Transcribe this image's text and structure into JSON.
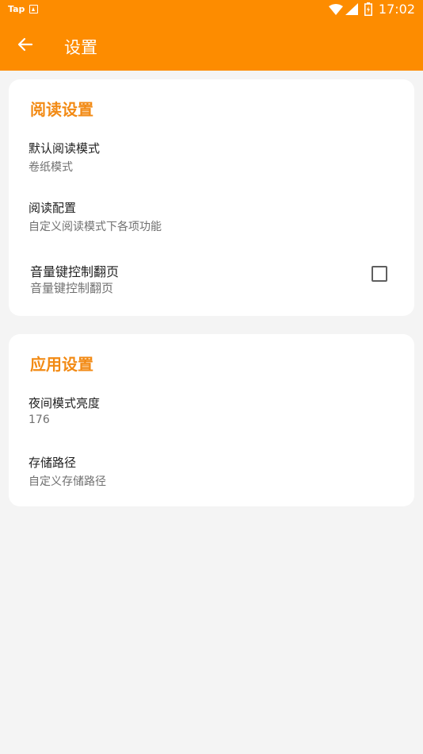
{
  "status_bar": {
    "app_label": "Tap",
    "time": "17:02",
    "icons": [
      "notification-a-icon",
      "wifi-icon",
      "signal-icon",
      "battery-icon"
    ]
  },
  "app_bar": {
    "title": "设置",
    "back_icon": "arrow-left-icon"
  },
  "reading_section": {
    "title": "阅读设置",
    "items": [
      {
        "title": "默认阅读模式",
        "summary": "卷纸模式"
      },
      {
        "title": "阅读配置",
        "summary": "自定义阅读模式下各项功能"
      },
      {
        "title": "音量键控制翻页",
        "summary": "音量键控制翻页",
        "checked": false
      }
    ]
  },
  "app_section": {
    "title": "应用设置",
    "items": [
      {
        "title": "夜间模式亮度",
        "summary": "176"
      },
      {
        "title": "存储路径",
        "summary": "自定义存储路径"
      }
    ]
  },
  "colors": {
    "primary": "#fd8c00",
    "section_title": "#f28a14",
    "background": "#f4f4f4",
    "card": "#ffffff"
  }
}
